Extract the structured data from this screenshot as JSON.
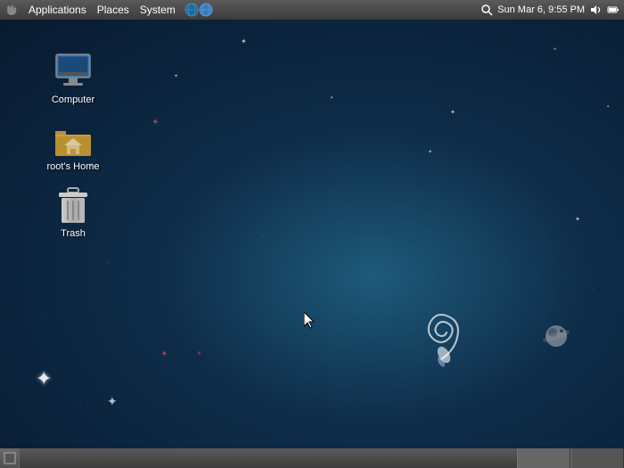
{
  "menubar": {
    "items": [
      {
        "id": "applications",
        "label": "Applications"
      },
      {
        "id": "places",
        "label": "Places"
      },
      {
        "id": "system",
        "label": "System"
      }
    ],
    "time": "Sun Mar 6, 9:55 PM",
    "logo_icon": "gnome-logo-icon"
  },
  "desktop": {
    "icons": [
      {
        "id": "computer",
        "label": "Computer",
        "type": "computer"
      },
      {
        "id": "roots-home",
        "label": "root's Home",
        "type": "home"
      },
      {
        "id": "trash",
        "label": "Trash",
        "type": "trash"
      }
    ]
  },
  "taskbar": {
    "items": []
  },
  "stars": {
    "description": "Various white and red star decorations on desktop background"
  }
}
